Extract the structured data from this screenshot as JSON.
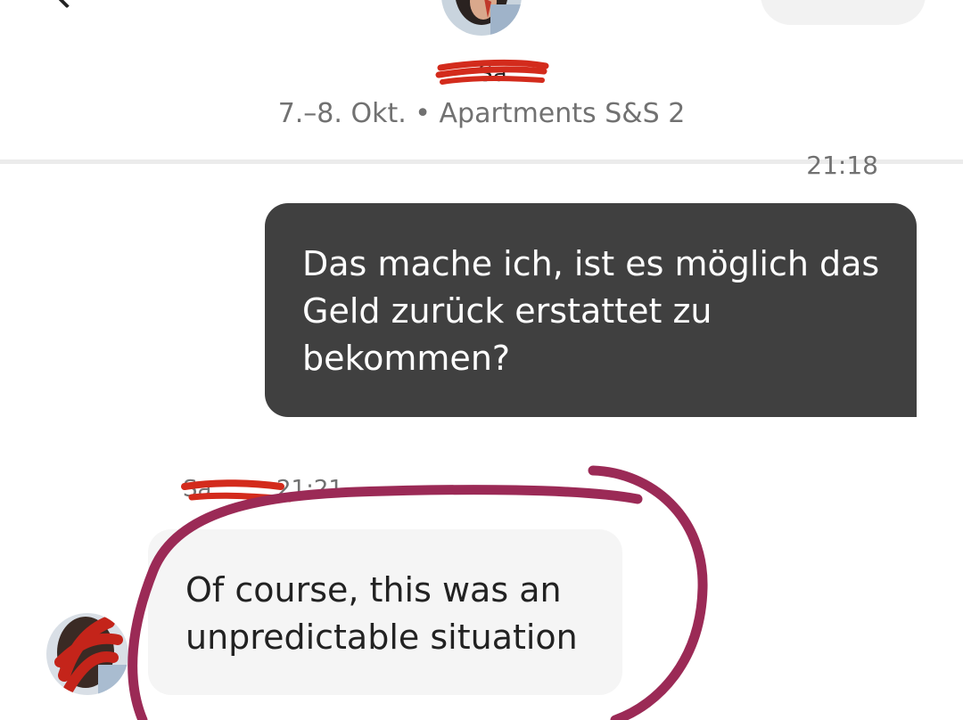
{
  "header": {
    "host_name": "Sa",
    "trip_info": "7.–8. Okt. • Apartments S&S 2"
  },
  "messages": {
    "outgoing": {
      "time": "21:18",
      "lines": [
        "Das mache ich, ist es möglich das",
        "Geld zurück erstattet zu",
        "bekommen?"
      ]
    },
    "incoming": {
      "sender": "Sa",
      "time": "21:21",
      "lines": [
        "Of course, this was an",
        "unpredictable situation"
      ]
    }
  },
  "colors": {
    "outgoing_bubble": "#404040",
    "incoming_bubble": "#f5f5f5",
    "redaction": "#d32b1c",
    "annotation_circle": "#9b2a56",
    "secondary_text": "#717171"
  },
  "icons": {
    "back": "chevron-left-icon"
  }
}
